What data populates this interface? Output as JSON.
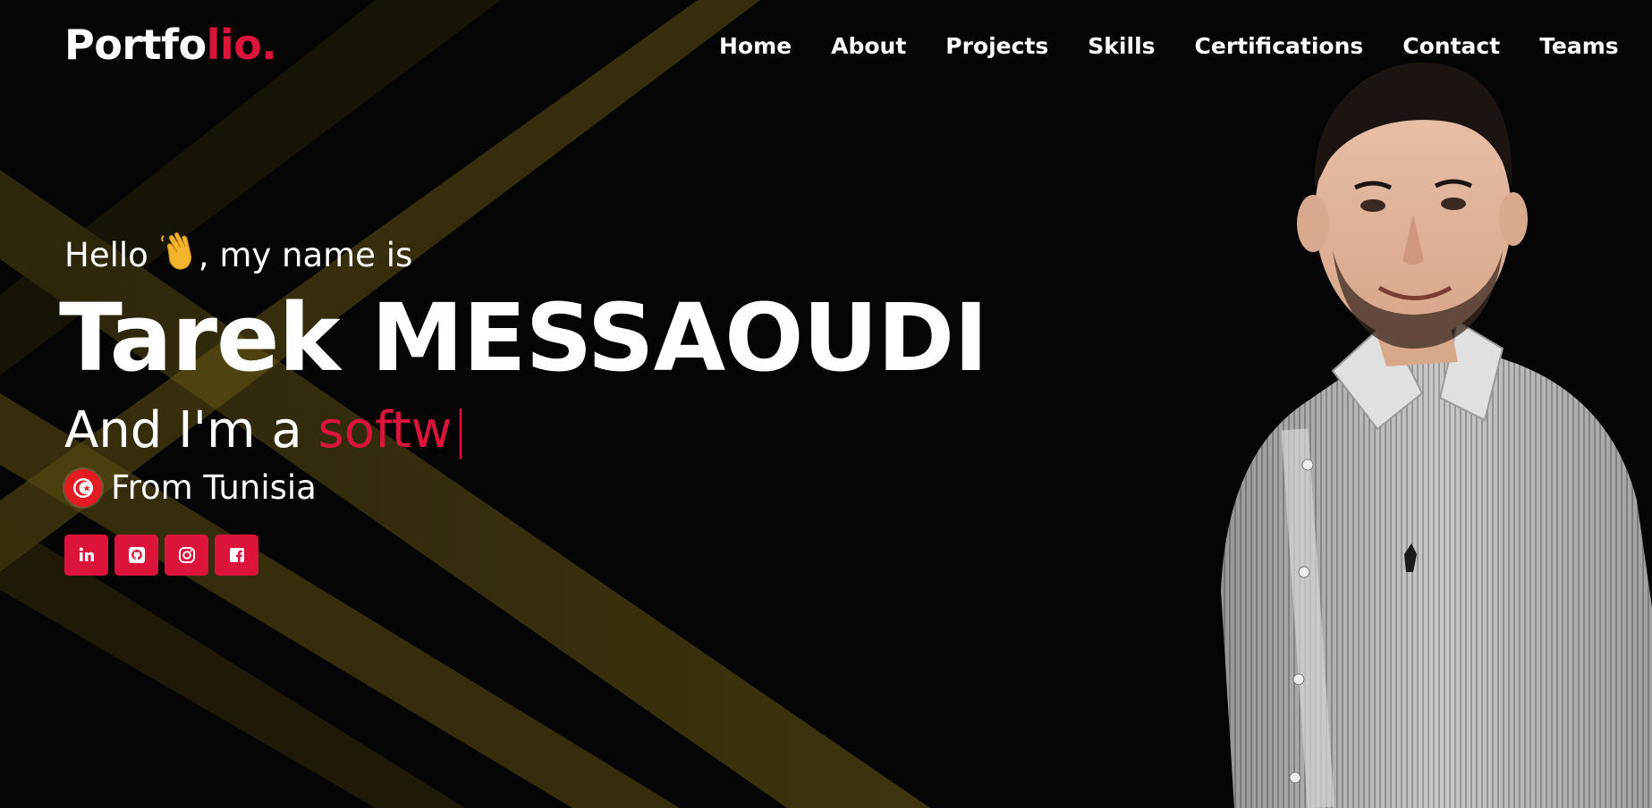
{
  "brand": {
    "logo_main": "Portfo",
    "logo_accent": "lio."
  },
  "nav": {
    "items": [
      "Home",
      "About",
      "Projects",
      "Skills",
      "Certifications",
      "Contact",
      "Teams"
    ]
  },
  "hero": {
    "greeting_start": "Hello",
    "greeting_end": ", my name is",
    "name": "Tarek MESSAOUDI",
    "role_prefix": "And I'm a ",
    "role_typed": "softw",
    "role_cursor": "|",
    "origin": "From Tunisia"
  },
  "social": [
    "linkedin-icon",
    "github-icon",
    "instagram-icon",
    "facebook-icon"
  ],
  "colors": {
    "accent": "#dc143c",
    "background": "#050505",
    "ray": "#6b5a14",
    "text": "#ffffff"
  }
}
